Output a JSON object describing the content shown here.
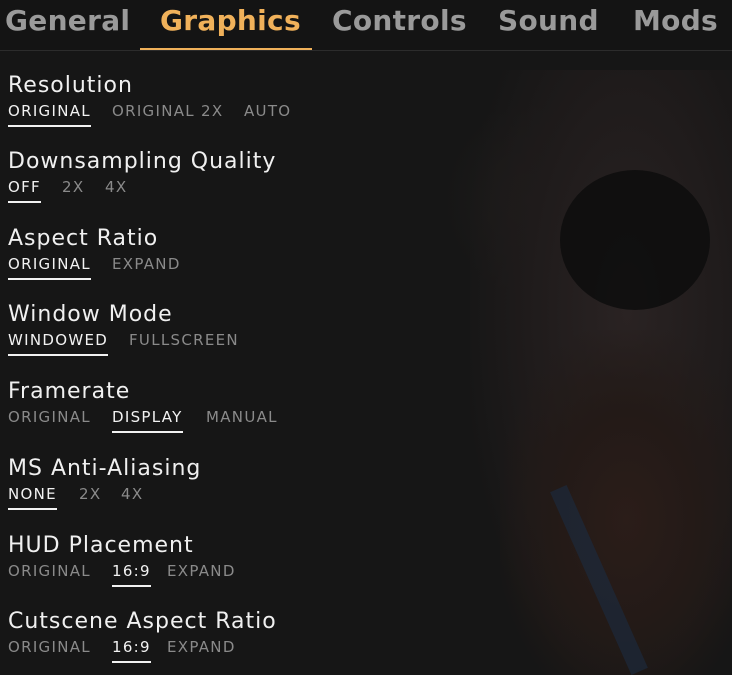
{
  "tabs": [
    {
      "label": "General"
    },
    {
      "label": "Graphics"
    },
    {
      "label": "Controls"
    },
    {
      "label": "Sound"
    },
    {
      "label": "Mods"
    }
  ],
  "active_tab": "Graphics",
  "accent_color": "#f0b15a",
  "settings": [
    {
      "title": "Resolution",
      "options": [
        "ORIGINAL",
        "ORIGINAL 2X",
        "AUTO"
      ],
      "selected": "ORIGINAL"
    },
    {
      "title": "Downsampling Quality",
      "options": [
        "OFF",
        "2X",
        "4X"
      ],
      "selected": "OFF"
    },
    {
      "title": "Aspect Ratio",
      "options": [
        "ORIGINAL",
        "EXPAND"
      ],
      "selected": "ORIGINAL"
    },
    {
      "title": "Window Mode",
      "options": [
        "WINDOWED",
        "FULLSCREEN"
      ],
      "selected": "WINDOWED"
    },
    {
      "title": "Framerate",
      "options": [
        "ORIGINAL",
        "DISPLAY",
        "MANUAL"
      ],
      "selected": "DISPLAY"
    },
    {
      "title": "MS Anti-Aliasing",
      "options": [
        "NONE",
        "2X",
        "4X"
      ],
      "selected": "NONE"
    },
    {
      "title": "HUD Placement",
      "options": [
        "ORIGINAL",
        "16:9",
        "EXPAND"
      ],
      "selected": "16:9"
    },
    {
      "title": "Cutscene Aspect Ratio",
      "options": [
        "ORIGINAL",
        "16:9",
        "EXPAND"
      ],
      "selected": "16:9"
    }
  ]
}
